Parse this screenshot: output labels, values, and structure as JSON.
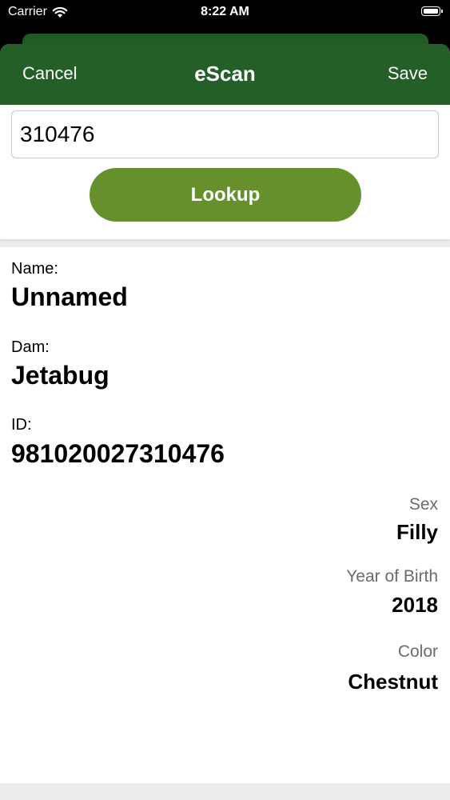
{
  "status_bar": {
    "carrier": "Carrier",
    "time": "8:22 AM"
  },
  "nav": {
    "cancel_label": "Cancel",
    "title": "eScan",
    "save_label": "Save"
  },
  "search": {
    "value": "310476",
    "button_label": "Lookup"
  },
  "details": {
    "name_label": "Name:",
    "name_value": "Unnamed",
    "dam_label": "Dam:",
    "dam_value": "Jetabug",
    "id_label": "ID:",
    "id_value": "981020027310476",
    "sex_label": "Sex",
    "sex_value": "Filly",
    "yob_label": "Year of Birth",
    "yob_value": "2018",
    "color_label": "Color",
    "color_value": "Chestnut"
  },
  "colors": {
    "nav_green": "#235f27",
    "button_green": "#66902b"
  }
}
